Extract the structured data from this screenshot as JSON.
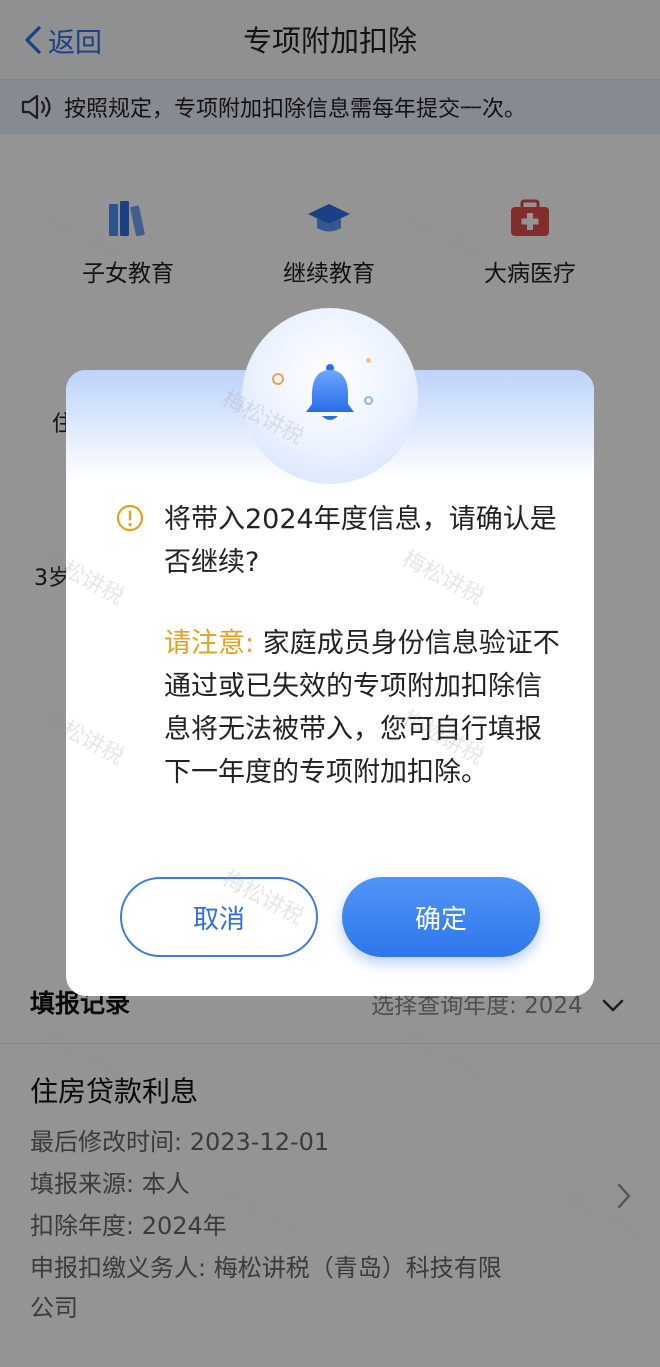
{
  "header": {
    "back_label": "返回",
    "title": "专项附加扣除"
  },
  "notice": {
    "text": "按照规定，专项附加扣除信息需每年提交一次。"
  },
  "categories": [
    {
      "label": "子女教育",
      "icon": "books-icon"
    },
    {
      "label": "继续教育",
      "icon": "graduation-cap-icon"
    },
    {
      "label": "大病医疗",
      "icon": "medical-kit-icon"
    }
  ],
  "background_peek": {
    "row2_left": "住",
    "row3_left": "3岁"
  },
  "dialog": {
    "message": "将带入2024年度信息，请确认是否继续?",
    "note_label": "请注意:",
    "note_text": "家庭成员身份信息验证不通过或已失效的专项附加扣除信息将无法被带入，您可自行填报下一年度的专项附加扣除。",
    "cancel_label": "取消",
    "confirm_label": "确定"
  },
  "records": {
    "header": "填报记录",
    "year_selector_label": "选择查询年度:",
    "year_value": "2024",
    "item": {
      "title": "住房贷款利息",
      "last_modified": "最后修改时间: 2023-12-01",
      "source": "填报来源: 本人",
      "year": "扣除年度: 2024年",
      "withholder_line1": "申报扣缴义务人: 梅松讲税（青岛）科技有限",
      "withholder_line2": "公司"
    }
  },
  "watermark": "梅松讲税",
  "colors": {
    "accent": "#2f6fe6",
    "warning": "#e8a21a"
  }
}
